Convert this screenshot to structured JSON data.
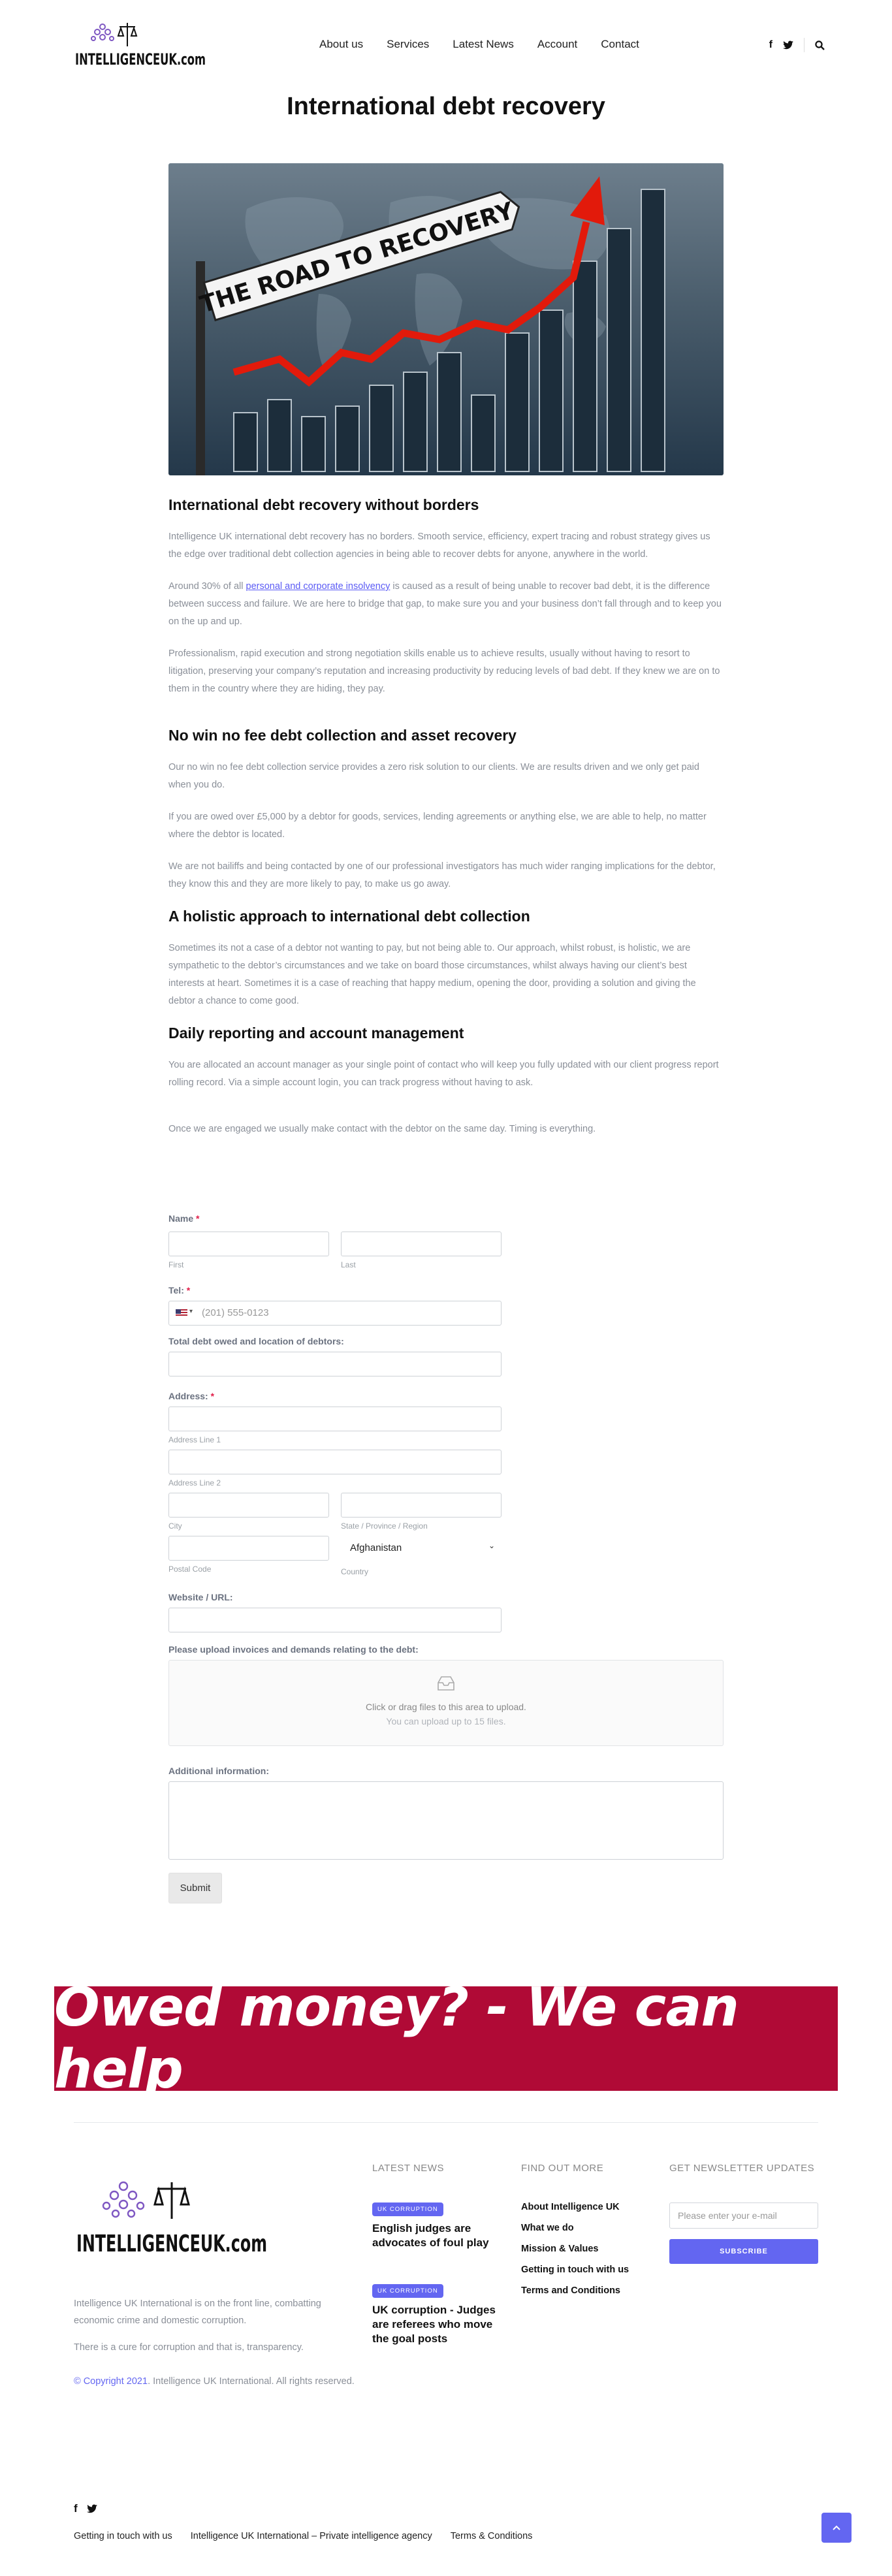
{
  "header": {
    "brand": "INTELLIGENCEUK.com",
    "nav": [
      "About us",
      "Services",
      "Latest News",
      "Account",
      "Contact"
    ]
  },
  "main": {
    "title": "International debt recovery",
    "hero_sign": "THE ROAD TO RECOVERY",
    "sections": [
      {
        "heading": "International debt recovery without borders",
        "paragraphs": [
          "Intelligence UK international debt recovery has no borders. Smooth service, efficiency, expert tracing and robust strategy gives us the edge over traditional debt collection agencies in being able to recover debts for anyone, anywhere in the world."
        ],
        "para2_before": "Around 30% of all ",
        "para2_link": "personal and corporate insolvency",
        "para2_after": " is caused as a result of being unable to recover bad debt, it is the difference between success and failure. We are here to bridge that gap, to make sure you and your business don’t fall through and to keep you on the up and up.",
        "para3": "Professionalism, rapid execution and strong negotiation skills enable us to achieve results, usually without having to resort to litigation, preserving your company’s reputation and increasing productivity by reducing levels of bad debt. If they knew we are on to them in the country where they are hiding, they pay."
      },
      {
        "heading": "No win no fee debt collection and asset recovery",
        "paragraphs": [
          "Our no win no fee debt collection service provides a zero risk solution to our clients. We are results driven and we only get paid when you do.",
          "If you are owed over £5,000 by a debtor for goods, services, lending agreements or anything else, we are able to help, no matter where the debtor is located.",
          "We are not bailiffs and being contacted by one of our professional investigators has much wider ranging implications for the debtor, they know this and they are more likely to pay, to make us go away."
        ]
      },
      {
        "heading": "A holistic approach to international debt collection",
        "paragraphs": [
          "Sometimes its not a case of a debtor not wanting to pay, but not being able to. Our approach, whilst robust, is holistic, we are sympathetic to the debtor’s circumstances and we take on board those circumstances, whilst always having our client’s best interests at heart. Sometimes it is a case of reaching that happy medium, opening the door, providing a solution and giving the debtor a chance to come good."
        ]
      },
      {
        "heading": "Daily reporting and account management",
        "paragraphs": [
          "You are allocated an account manager as your single point of contact who will keep you fully updated with our client progress report rolling record. Via a simple account login, you can track progress without having to ask.",
          "Once we are engaged we usually make contact with the debtor on the same day. Timing is everything."
        ]
      }
    ]
  },
  "form": {
    "name_label": "Name",
    "first_label": "First",
    "last_label": "Last",
    "tel_label": "Tel:",
    "tel_placeholder": "(201) 555-0123",
    "debt_label": "Total debt owed and location of debtors:",
    "address_label": "Address:",
    "address1_label": "Address Line 1",
    "address2_label": "Address Line 2",
    "city_label": "City",
    "state_label": "State / Province / Region",
    "postal_label": "Postal Code",
    "country_label": "Country",
    "country_value": "Afghanistan",
    "website_label": "Website / URL:",
    "upload_label": "Please upload invoices and demands relating to the debt:",
    "upload_text": "Click or drag files to this area to upload.",
    "upload_sub": "You can upload up to 15 files.",
    "additional_label": "Additional information:",
    "submit_label": "Submit",
    "required_mark": "*"
  },
  "banner": {
    "text": "Owed money?  - We can help"
  },
  "footer": {
    "brand": "INTELLIGENCEUK.com",
    "about_1": "Intelligence UK International is on the front line, combatting economic crime and domestic corruption.",
    "about_2": "There is a cure for corruption and that is, transparency.",
    "copyright_link": "© Copyright 2021",
    "copyright_rest": ". Intelligence UK International. All rights reserved.",
    "latest_news_heading": "LATEST NEWS",
    "news": [
      {
        "badge": "UK CORRUPTION",
        "title": "English judges are advocates of foul play"
      },
      {
        "badge": "UK CORRUPTION",
        "title": "UK corruption - Judges are referees who move the goal posts"
      }
    ],
    "find_out_heading": "FIND OUT MORE",
    "links": [
      "About Intelligence UK",
      "What we do",
      "Mission & Values",
      "Getting in touch with us",
      "Terms and Conditions"
    ],
    "newsletter_heading": "GET NEWSLETTER UPDATES",
    "newsletter_placeholder": "Please enter your e-mail",
    "subscribe_label": "SUBSCRIBE",
    "bottom_links": [
      "Getting in touch with us",
      "Intelligence UK International – Private intelligence agency",
      "Terms & Conditions"
    ]
  },
  "colors": {
    "accent": "#6366f1",
    "banner": "#b00a36",
    "required": "#e11d48"
  }
}
